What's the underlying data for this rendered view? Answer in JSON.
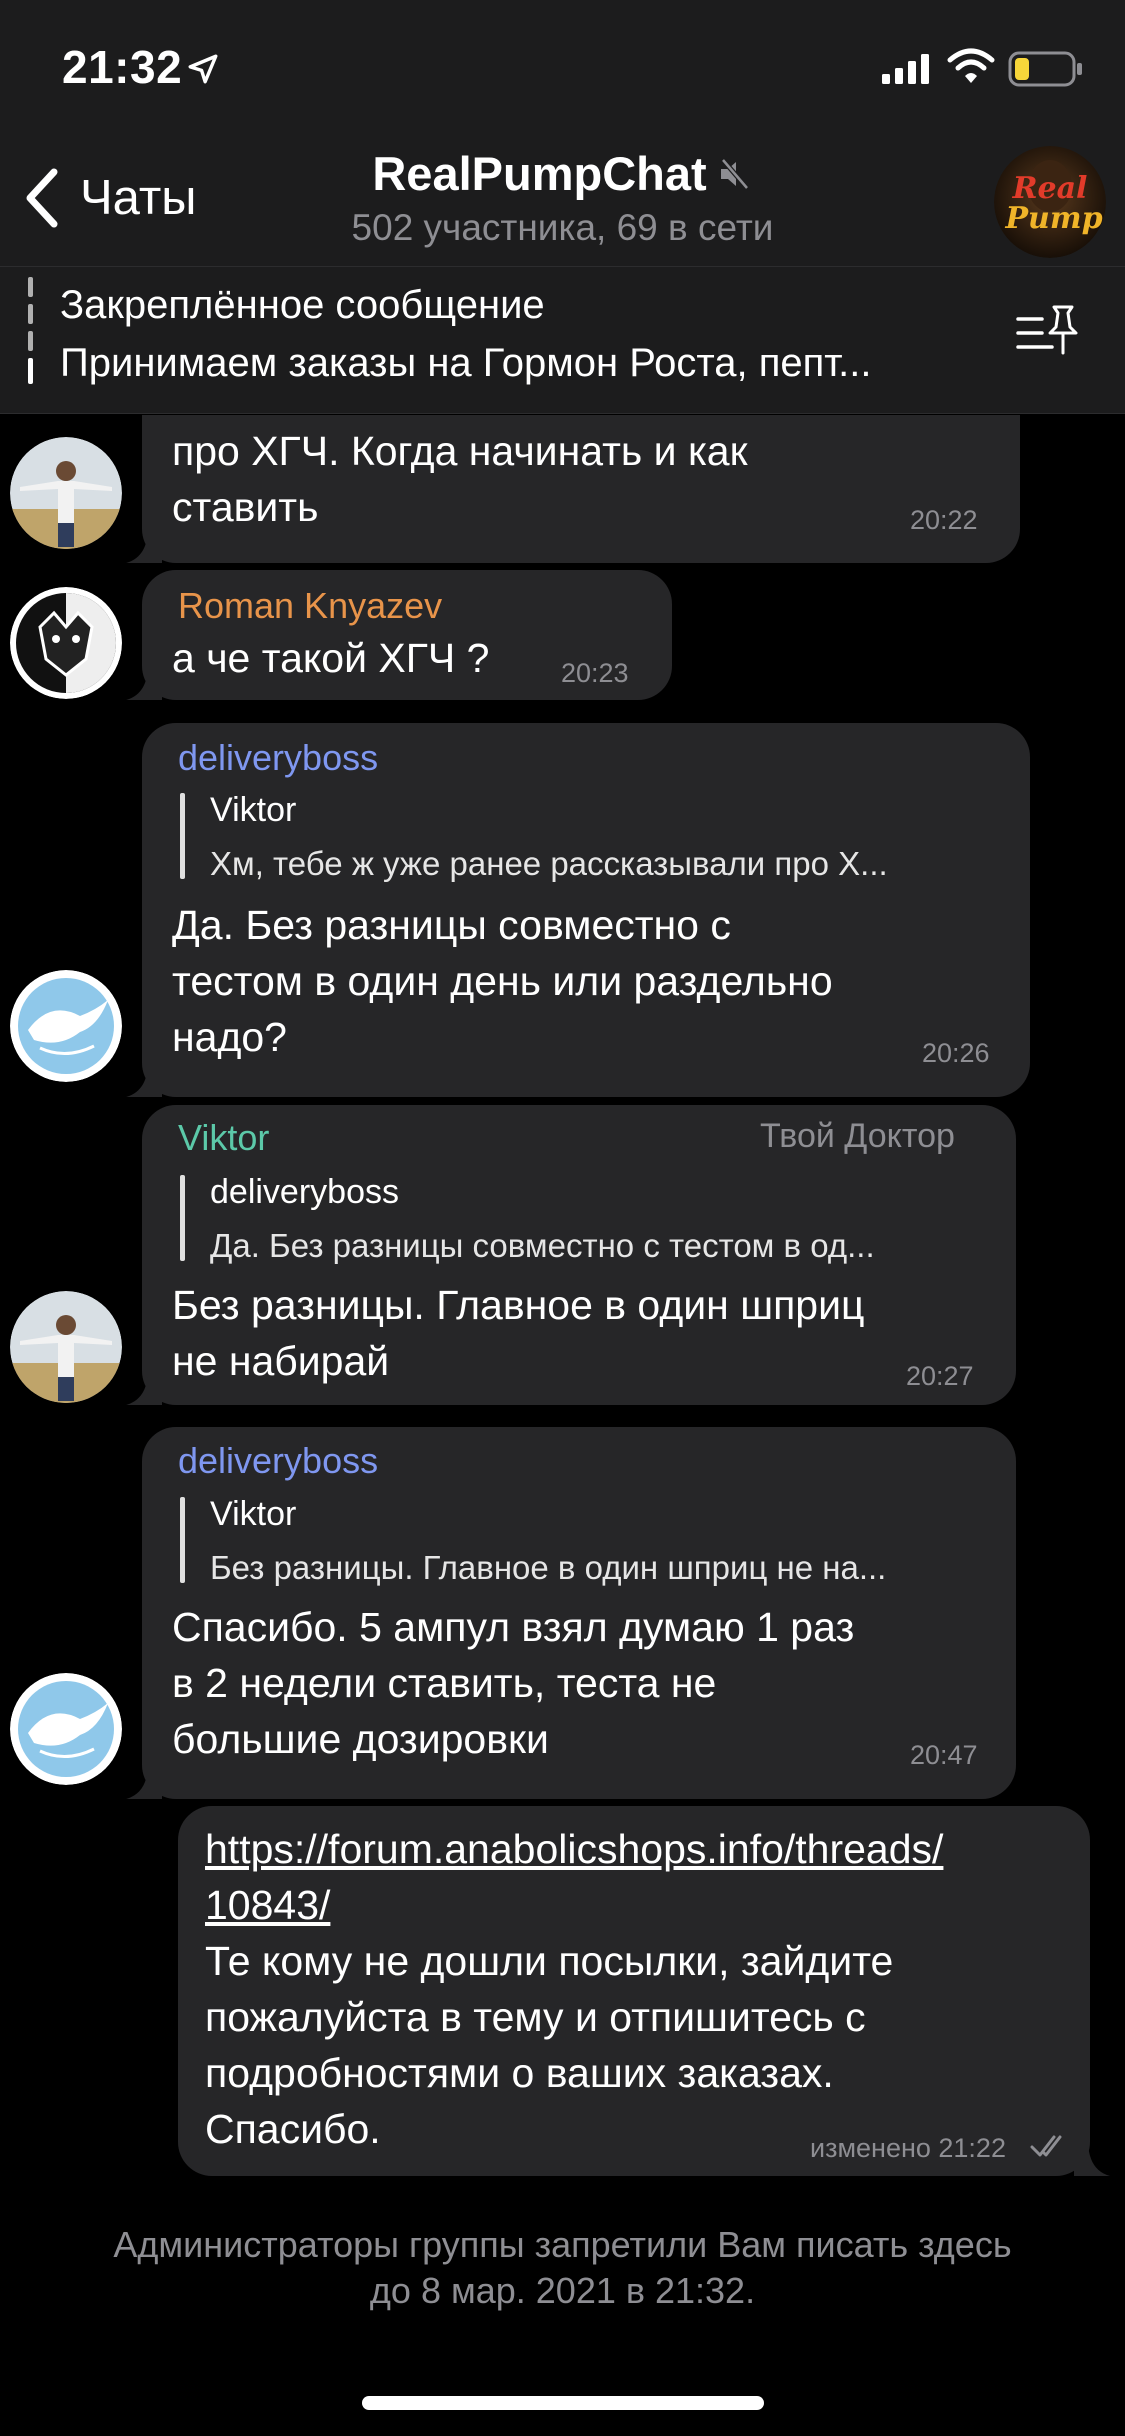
{
  "status_bar": {
    "time": "21:32"
  },
  "header": {
    "back_label": "Чаты",
    "title": "RealPumpChat",
    "subtitle": "502 участника, 69 в сети",
    "avatar_text_line1": "Real",
    "avatar_text_line2": "Pump"
  },
  "pinned": {
    "title": "Закреплённое сообщение",
    "text": "Принимаем заказы на Гормон Роста, пепт..."
  },
  "messages": [
    {
      "sender": "",
      "lines": [
        "про ХГЧ. Когда начинать и как",
        "ставить"
      ],
      "time": "20:22"
    },
    {
      "sender": "Roman Knyazev",
      "lines": [
        "а че такой ХГЧ ?"
      ],
      "time": "20:23"
    },
    {
      "sender": "deliveryboss",
      "reply_name": "Viktor",
      "reply_text": "Хм, тебе ж уже ранее рассказывали про Х...",
      "lines": [
        "Да. Без разницы совместно с",
        "тестом в один день или раздельно",
        "надо?"
      ],
      "time": "20:26"
    },
    {
      "sender": "Viktor",
      "admin_title": "Твой Доктор",
      "reply_name": "deliveryboss",
      "reply_text": "Да. Без разницы совместно с тестом в од...",
      "lines": [
        "Без разницы. Главное в один шприц",
        "не набирай"
      ],
      "time": "20:27"
    },
    {
      "sender": "deliveryboss",
      "reply_name": "Viktor",
      "reply_text": "Без разницы. Главное в один шприц не на...",
      "lines": [
        "Спасибо. 5 ампул взял думаю 1 раз",
        "в 2 недели ставить, теста не",
        "большие дозировки"
      ],
      "time": "20:47"
    },
    {
      "outgoing": true,
      "link_lines": [
        "https://forum.anabolicshops.info/threads/",
        "10843/"
      ],
      "lines": [
        "Те кому не дошли посылки, зайдите",
        "пожалуйста в тему и отпишитесь с",
        "подробностями о ваших заказах.",
        "Спасибо."
      ],
      "time": "изменено 21:22"
    }
  ],
  "footer": {
    "line1": "Администраторы группы запретили Вам писать здесь",
    "line2": "до 8 мар. 2021 в 21:32."
  },
  "colors": {
    "background": "#000000",
    "bar": "#1c1c1d",
    "bubble": "#262628",
    "name_orange": "#e8944a",
    "name_blue": "#7f97f0",
    "name_teal": "#5cc9a9",
    "muted_text": "#8e8e93"
  }
}
